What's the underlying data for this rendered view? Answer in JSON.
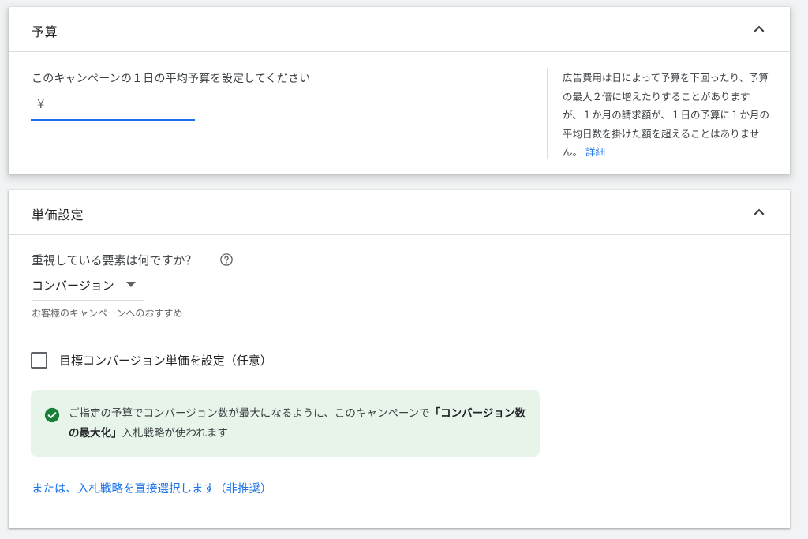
{
  "budget": {
    "title": "予算",
    "prompt": "このキャンペーンの１日の平均予算を設定してください",
    "currency": "¥",
    "input_value": "",
    "help_text": "広告費用は日によって予算を下回ったり、予算の最大２倍に増えたりすることがありますが、１か月の請求額が、１日の予算に１か月の平均日数を掛けた額を超えることはありません。",
    "help_link": "詳細"
  },
  "bidding": {
    "title": "単価設定",
    "question": "重視している要素は何ですか？",
    "selected": "コンバージョン",
    "recommend_note": "お客様のキャンペーンへのおすすめ",
    "target_cpa_label": "目標コンバージョン単価を設定（任意）",
    "target_cpa_checked": false,
    "info_prefix": "ご指定の予算でコンバージョン数が最大になるように、このキャンペーンで",
    "info_strategy": "「コンバージョン数の最大化」",
    "info_suffix": "入札戦略が使われます",
    "manual_link": "または、入札戦略を直接選択します（非推奨）"
  },
  "colors": {
    "accent": "#1a73e8",
    "success": "#188038",
    "success_bg": "#e6f4ea"
  },
  "icons": {
    "collapse": "chevron-up-icon",
    "help": "help-circle-icon",
    "dropdown": "caret-down-icon",
    "success": "check-circle-icon"
  }
}
